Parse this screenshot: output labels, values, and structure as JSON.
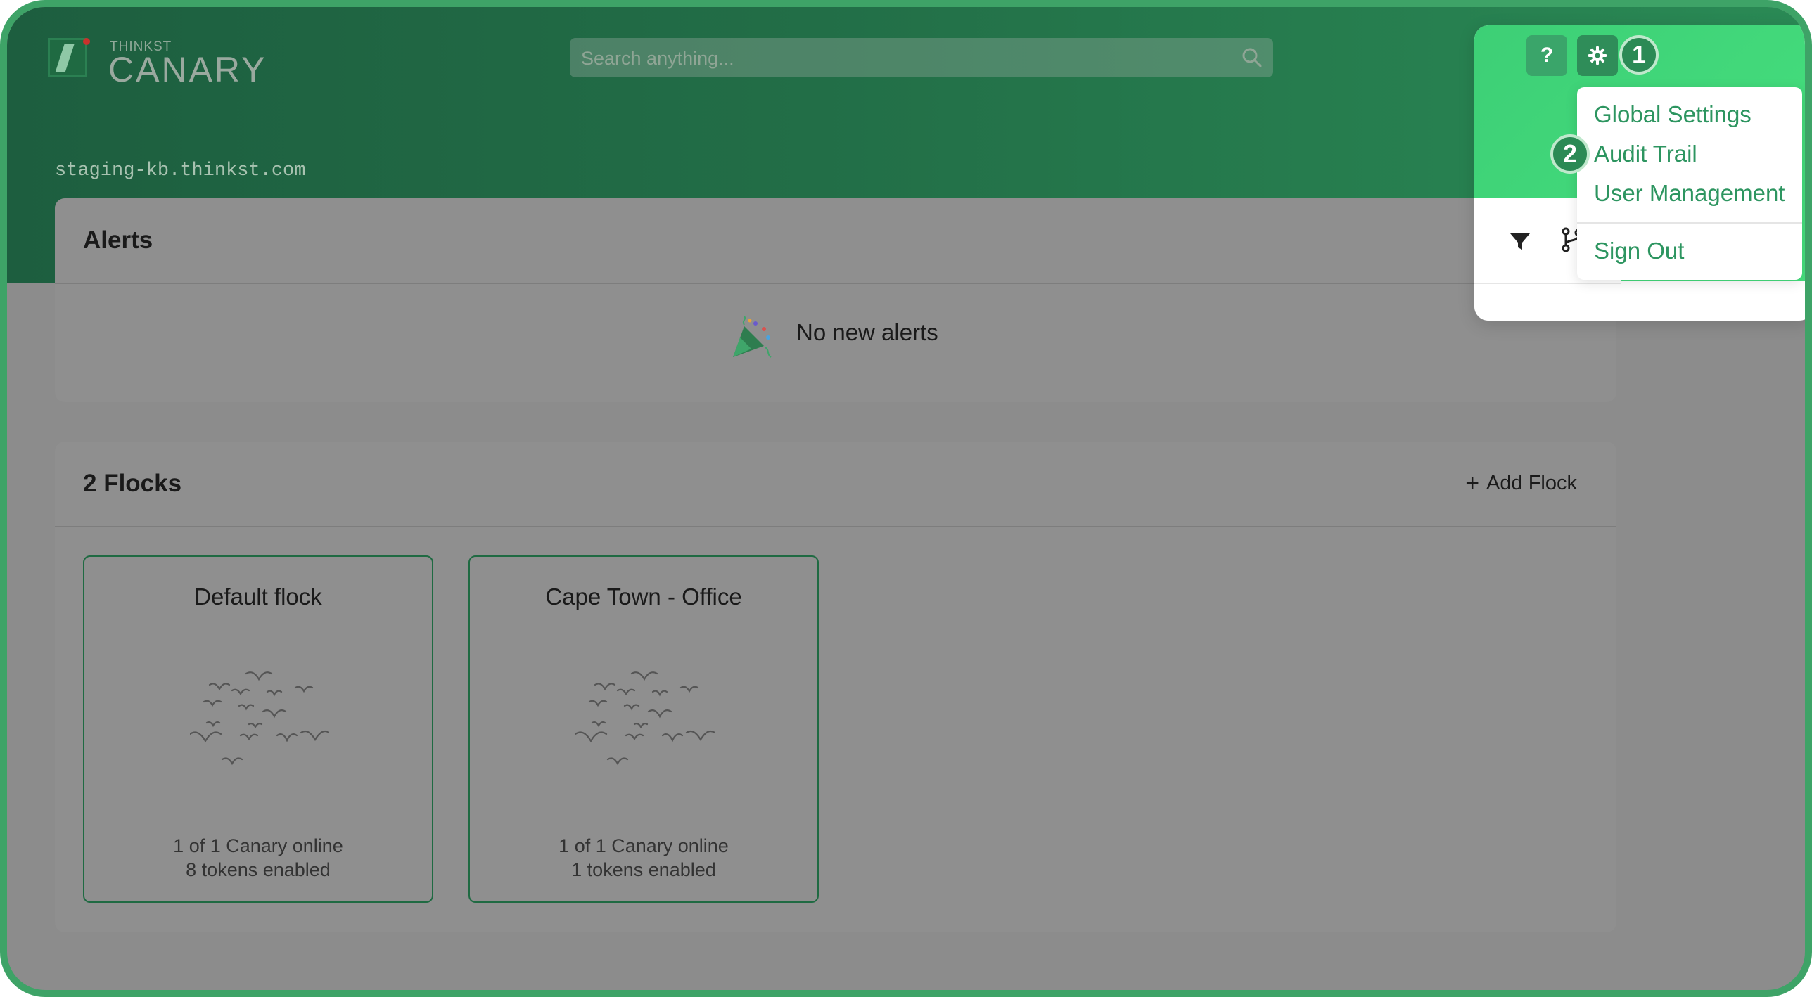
{
  "brand": {
    "small": "THINKST",
    "big": "CANARY"
  },
  "search": {
    "placeholder": "Search anything..."
  },
  "hostname": "staging-kb.thinkst.com",
  "alerts": {
    "title": "Alerts",
    "empty_text": "No new alerts"
  },
  "flocks": {
    "title": "2 Flocks",
    "add_label": "Add Flock",
    "items": [
      {
        "name": "Default flock",
        "online": "1 of 1 Canary online",
        "tokens": "8 tokens enabled"
      },
      {
        "name": "Cape Town - Office",
        "online": "1 of 1 Canary online",
        "tokens": "1 tokens enabled"
      }
    ]
  },
  "topbar": {
    "help_label": "?"
  },
  "settings_menu": {
    "items": [
      "Global Settings",
      "Audit Trail",
      "User Management"
    ],
    "sign_out": "Sign Out"
  },
  "steps": {
    "first": "1",
    "second": "2"
  },
  "colors": {
    "brand_green": "#1f6a42",
    "accent_green": "#46e07e",
    "link_green": "#2d9560",
    "overlay_grey": "#8c8c8c"
  },
  "icons": [
    "search-icon",
    "question-icon",
    "gear-icon",
    "filter-icon",
    "branch-icon",
    "party-popper-icon",
    "plus-icon",
    "birds-icon"
  ]
}
